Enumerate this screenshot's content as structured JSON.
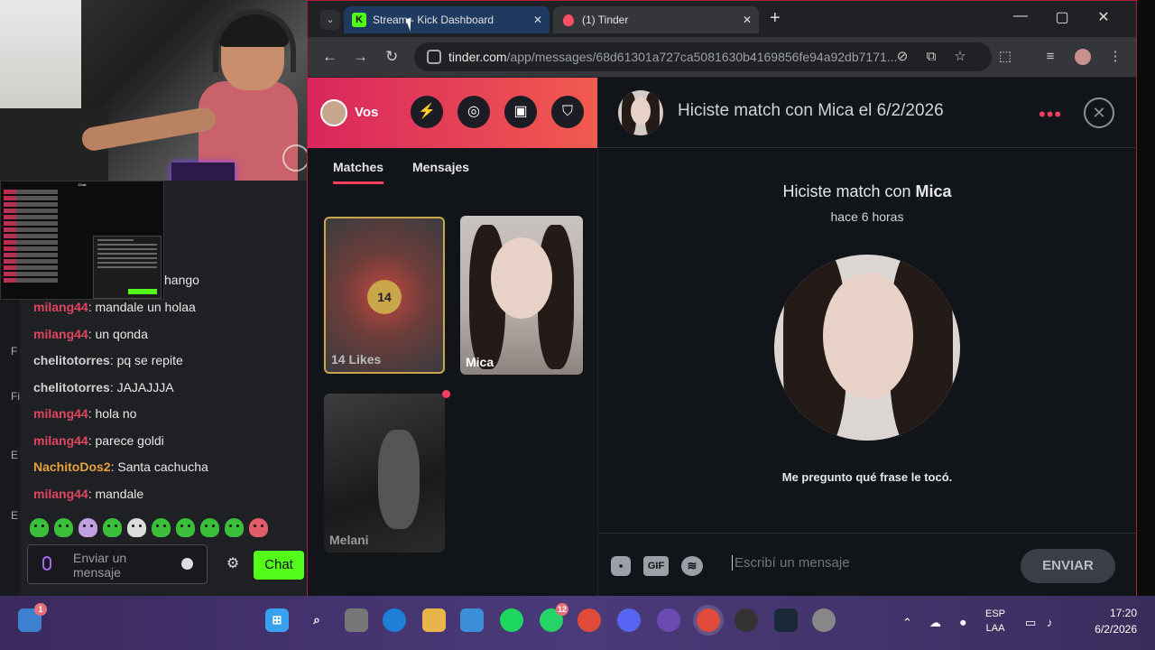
{
  "browser": {
    "tabs": [
      {
        "label": "Stream - Kick Dashboard",
        "icon": "kick-logo-icon",
        "active": false
      },
      {
        "label": "(1) Tinder",
        "icon": "tinder-flame-icon",
        "active": true
      }
    ],
    "kick_favicon": "K",
    "url_domain": "tinder.com",
    "url_path": "/app/messages/68d61301a727ca5081630b4169856fe94a92db7171..."
  },
  "tinder": {
    "profile_label": "Vos",
    "tabs": [
      "Matches",
      "Mensajes"
    ],
    "likes_count": "14",
    "likes_label": "14 Likes",
    "match_cards": [
      {
        "name": "Mica"
      },
      {
        "name": "Melani"
      }
    ],
    "header_title": "Hiciste match con Mica el 6/2/2026",
    "match_title_prefix": "Hiciste match con ",
    "match_name": "Mica",
    "match_time": "hace 6 horas",
    "prompt": "Me pregunto qué frase le tocó.",
    "composer_placeholder": "Escribí un mensaje",
    "gif_label": "GIF",
    "send_label": "ENVIAR",
    "colors": {
      "brand_start": "#d9265d",
      "brand_end": "#f15a4f",
      "accent": "#fd3f5f"
    }
  },
  "chat": {
    "partial_message": "hango",
    "partial_first_line": "milang44: mandale un holaa",
    "messages": [
      {
        "user": "milang44",
        "color": "#e0455f",
        "text": "mandale un holaa"
      },
      {
        "user": "milang44",
        "color": "#e0455f",
        "text": "un qonda"
      },
      {
        "user": "chelitotorres",
        "color": "#d0d0d0",
        "text": "pq se repite"
      },
      {
        "user": "chelitotorres",
        "color": "#d0d0d0",
        "text": "JAJAJJJA"
      },
      {
        "user": "milang44",
        "color": "#e0455f",
        "text": "hola no"
      },
      {
        "user": "milang44",
        "color": "#e0455f",
        "text": "parece goldi"
      },
      {
        "user": "NachitoDos2",
        "color": "#e6a23c",
        "text": "Santa cachucha"
      },
      {
        "user": "milang44",
        "color": "#e0455f",
        "text": "mandale"
      }
    ],
    "input_placeholder": "Enviar un mensaje",
    "send_label": "Chat",
    "mini_title": "Chat",
    "kick_green": "#53fc18"
  },
  "taskbar": {
    "language": "ESP",
    "layout": "LAA",
    "time": "17:20",
    "date": "6/2/2026",
    "whatsapp_badge": "12"
  }
}
